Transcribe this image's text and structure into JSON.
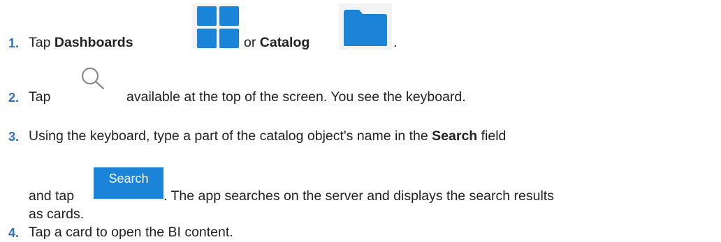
{
  "steps": [
    {
      "number": "1.",
      "prefix": "Tap ",
      "bold1": "Dashboards",
      "middle": " or ",
      "bold2": "Catalog",
      "suffix": "."
    },
    {
      "number": "2.",
      "prefix": "Tap",
      "suffix": "available at the top of the screen. You see the keyboard."
    },
    {
      "number": "3.",
      "line1_prefix": "Using the keyboard, type a part of the catalog object's name in the ",
      "line1_bold": "Search",
      "line1_suffix": " field",
      "line2_prefix": "and tap",
      "button_label": "Search",
      "line2_suffix": ". The app searches on the server and displays the search results",
      "line3": "as cards."
    },
    {
      "number": "4.",
      "text": "Tap a card to open the BI content."
    }
  ],
  "colors": {
    "step_number": "#2f6fb5",
    "icon_blue": "#1b84d6",
    "text": "#222222"
  },
  "icons": [
    "dashboards-grid-icon",
    "catalog-folder-icon",
    "search-magnifier-icon"
  ]
}
